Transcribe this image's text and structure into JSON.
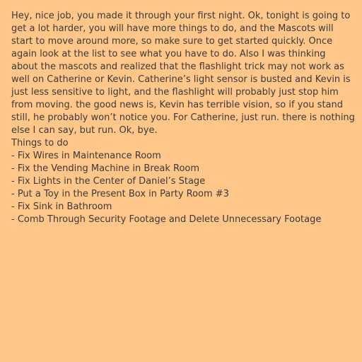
{
  "colors": {
    "background": "#ffc689",
    "text": "#3a3a3a"
  },
  "message": "Hey, nice job, you made it through your first night. Ok, tonight is going to get a lot harder, you will have more things to do, and the Mascots will start to move around more, so make sure to get started quickly. Once again look at the list to see what you have to do. Also I was thinking about the mascots and realized that the flashlight trick may not work as well on Catherine or Kevin. Catherine’s light sensor is busted and Kevin is just less sensitive to light, and the flashlight will probably just stop him from moving. the good news is, Kevin has terrible vision, so if you stand still, he probably won’t notice you. For Catherine, just run. there is nothing else I can say, but run. Ok, bye.",
  "todo": {
    "heading": "Things to do",
    "items": [
      "- Fix Wires in Maintenance Room",
      "- Fix the Vending Machine in Break Room",
      "- Fix Lights in the Center of Daniel’s Stage",
      "- Put a Toy in the Present Box in Party Room #3",
      "- Fix Sink in Bathroom",
      "- Comb Through Security Footage and Delete Unnecessary Footage"
    ]
  }
}
